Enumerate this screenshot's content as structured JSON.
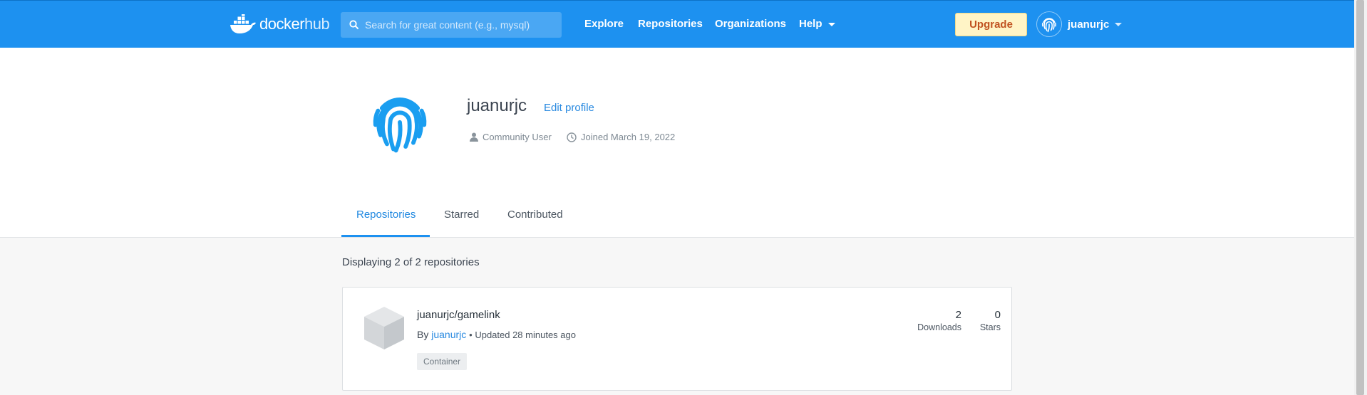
{
  "brand": {
    "logo_docker": "docker",
    "logo_hub": "hub"
  },
  "search": {
    "placeholder": "Search for great content (e.g., mysql)",
    "value": ""
  },
  "nav": {
    "explore": "Explore",
    "repositories": "Repositories",
    "organizations": "Organizations",
    "help": "Help"
  },
  "account": {
    "upgrade": "Upgrade",
    "username": "juanurjc"
  },
  "profile": {
    "username": "juanurjc",
    "edit_label": "Edit profile",
    "role": "Community User",
    "joined": "Joined March 19, 2022"
  },
  "tabs": [
    {
      "label": "Repositories",
      "active": true
    },
    {
      "label": "Starred",
      "active": false
    },
    {
      "label": "Contributed",
      "active": false
    }
  ],
  "listing": {
    "summary": "Displaying 2 of 2 repositories",
    "repos": [
      {
        "name": "juanurjc/gamelink",
        "by_prefix": "By",
        "owner": "juanurjc",
        "updated": "• Updated 28 minutes ago",
        "tag": "Container",
        "downloads": "2",
        "downloads_label": "Downloads",
        "stars": "0",
        "stars_label": "Stars"
      }
    ]
  },
  "colors": {
    "topbar": "#1d91f0",
    "accent": "#2a8ae0",
    "upgrade_bg": "#fff4c6",
    "upgrade_text": "#c0511f"
  },
  "icons": [
    "docker-whale-icon",
    "search-icon",
    "chevron-down-icon",
    "fingerprint-avatar-icon",
    "user-icon",
    "clock-icon",
    "cube-icon"
  ]
}
